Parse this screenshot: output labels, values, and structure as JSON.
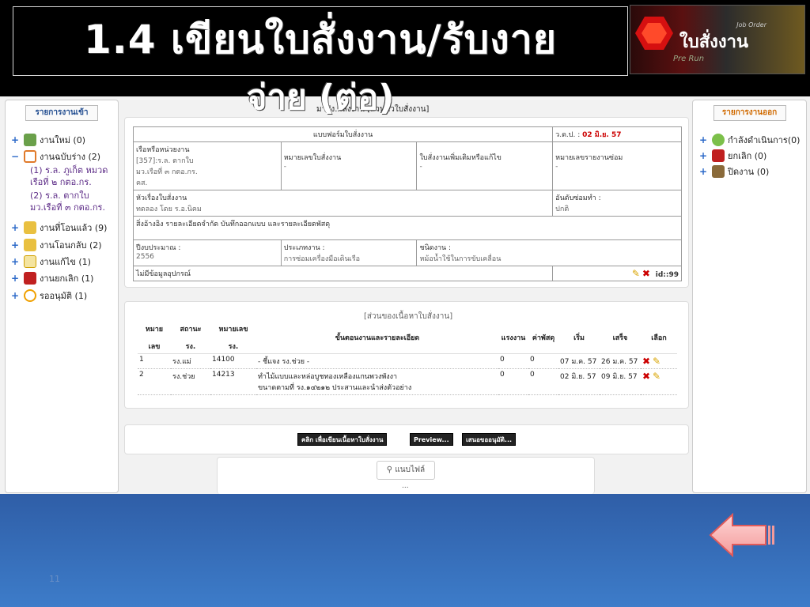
{
  "slide": {
    "title_line1": "1.4  เขียนใบสั่งงาน/รับงาย",
    "title_line2": "จ่าย (ต่อ)",
    "page_number": "11"
  },
  "logo": {
    "text_main": "ใบสั่งงาน",
    "text_small": "Job Order",
    "text_sub": "Pre Run"
  },
  "left_sidebar": {
    "heading": "รายการงานเข้า",
    "items": [
      {
        "toggle": "+",
        "label": "งานใหม่ (0)",
        "icon": "new-job-icon",
        "color": "#6aa04a"
      },
      {
        "toggle": "−",
        "label": "งานฉบับร่าง (2)",
        "icon": "draft-icon",
        "color": "#e07a2a"
      },
      {
        "toggle": "+",
        "label": "งานที่โอนแล้ว (9)",
        "icon": "transferred-icon",
        "color": "#6aa04a"
      },
      {
        "toggle": "+",
        "label": "งานโอนกลับ (2)",
        "icon": "returned-icon",
        "color": "#6aa04a"
      },
      {
        "toggle": "+",
        "label": "งานแก้ไข (1)",
        "icon": "edit-icon",
        "color": "#e0b020"
      },
      {
        "toggle": "+",
        "label": "งานยกเลิก (1)",
        "icon": "cancel-icon",
        "color": "#c02020"
      },
      {
        "toggle": "+",
        "label": "รออนุมัติ (1)",
        "icon": "clock-icon",
        "color": "#f0a000"
      }
    ],
    "draft_subitems": [
      {
        "line1": "(1) ร.ล. ภูเก็ต หมวด",
        "line2": "เรือที่ ๒ กตอ.กร."
      },
      {
        "line1": "(2) ร.ล. ตากใบ",
        "line2": "มว.เรือที่ ๓ กตอ.กร."
      }
    ]
  },
  "right_sidebar": {
    "heading": "รายการงานออก",
    "items": [
      {
        "toggle": "+",
        "label": "กำลังดำเนินการ(0)",
        "icon": "in-progress-icon",
        "color": "#7cc04a"
      },
      {
        "toggle": "+",
        "label": "ยกเลิก (0)",
        "icon": "cancel-icon",
        "color": "#c02020"
      },
      {
        "toggle": "+",
        "label": "ปิดงาน (0)",
        "icon": "close-job-icon",
        "color": "#8a6a3a"
      }
    ]
  },
  "main": {
    "breadcrumb": "มาส่ง...สั่งงาน [ส่วนหัวใบสั่งงาน]",
    "form": {
      "form_title": "แบบฟอร์มใบสั่งงาน",
      "date_label": "ว.ด.ป. :",
      "date_value": "02 มิ.ย. 57",
      "ship_label": "เรือหรือหน่วยงาน",
      "ship_value_1": "[357]:ร.ล. ตากใบ",
      "ship_value_2": "มว.เรือที่ ๓ กตอ.กร.",
      "ship_value_3": "คส.",
      "order_no_label": "หมายเลขใบสั่งงาน",
      "order_no_value": "-",
      "extra_label": "ใบสั่งงานเพิ่มเติมหรือแก้ไข",
      "extra_value": "-",
      "repair_report_label": "หมายเลขรายงานซ่อม",
      "repair_report_value": "-",
      "subject_label": "หัวเรื่องใบสั่งงาน",
      "subject_value": "ทดลอง โดย ร.อ.นิคม",
      "priority_label": "อันดับซ่อมทำ :",
      "priority_value": "ปกติ",
      "reference_text": "สิ่งอ้างอิง รายละเอียดจำกัด บันทึกออกแบบ และรายละเอียดพัสดุ",
      "budget_year_label": "ปีงบประมาณ :",
      "budget_year_value": "2556",
      "job_type_label": "ประเภทงาน :",
      "job_type_value": "การซ่อมเครื่องมือเดินเรือ",
      "job_kind_label": "ชนิดงาน :",
      "job_kind_value": "หม้อน้ำใช้ในการขับเคลื่อน",
      "equipment_text": "ไม่มีข้อมูลอุปกรณ์",
      "id_text": "id::99"
    },
    "detail": {
      "section_title": "[ส่วนของเนื้อหาใบสั่งงาน]",
      "headers": {
        "no_line1": "หมาย",
        "no_line2": "เลข",
        "status_line1": "สถานะ",
        "status_line2": "รง.",
        "code_line1": "หมายเลข",
        "code_line2": "รง.",
        "steps": "ขั้นตอนงานและรายละเอียด",
        "labor": "แรงงาน",
        "parts": "ค่าพัสดุ",
        "start": "เริ่ม",
        "finish": "เสร็จ",
        "select": "เลือก"
      },
      "rows": [
        {
          "no": "1",
          "status": "รง.แม่",
          "code": "14100",
          "steps_line1": "- ชี้แจง รง.ช่วย -",
          "steps_line2": "",
          "labor": "0",
          "parts": "0",
          "start": "07 ม.ค. 57",
          "finish": "26 ม.ค. 57"
        },
        {
          "no": "2",
          "status": "รง.ช่วย",
          "code": "14213",
          "steps_line1": "ทำไม้แบบและหล่อบูชทองเหลืองแกนพวงพังงา",
          "steps_line2": "ขนาดตามที่ รง.๑๔๒๑๒ ประสานและนำส่งตัวอย่าง",
          "labor": "0",
          "parts": "0",
          "start": "02 มิ.ย. 57",
          "finish": "09 มิ.ย. 57"
        }
      ]
    },
    "buttons": {
      "write_content": "คลิก เพื่อเขียนเนื้อหาใบสั่งงาน",
      "preview": "Preview...",
      "submit_approval": "เสนอขออนุมัติ...",
      "attach_file": "แนบไฟล์",
      "ellipsis": "..."
    }
  },
  "colors": {
    "slide_top": "#000000",
    "slide_bottom": "#3d7cc9",
    "date_red": "#cc0000",
    "right_heading": "#d06a00",
    "left_heading": "#1f4b8f"
  }
}
